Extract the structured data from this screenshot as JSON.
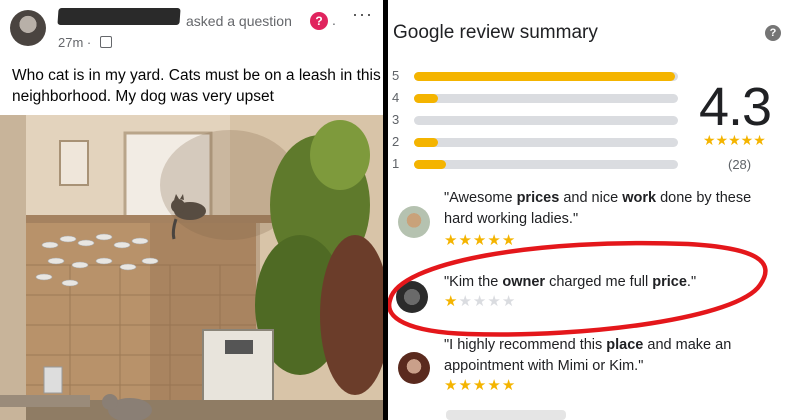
{
  "post": {
    "author_redacted": true,
    "action_text": "asked a question",
    "question_badge": "?",
    "dot": ".",
    "more": "···",
    "time": "27m ·",
    "body": "Who cat is in my yard.   Cats must be on a leash in this neighborhood.  My dog was very upset"
  },
  "review_summary": {
    "title": "Google review summary",
    "help": "?",
    "rating": "4.3",
    "stars": "★★★★★",
    "count": "(28)",
    "bars": [
      {
        "label": "5",
        "fraction": 0.99
      },
      {
        "label": "4",
        "fraction": 0.09
      },
      {
        "label": "3",
        "fraction": 0.0
      },
      {
        "label": "2",
        "fraction": 0.09
      },
      {
        "label": "1",
        "fraction": 0.12
      }
    ],
    "reviews": [
      {
        "parts": [
          "\"Awesome ",
          "prices",
          " and nice ",
          "work",
          " done by these hard working ladies.\""
        ],
        "rating": 5
      },
      {
        "parts": [
          "\"Kim the ",
          "owner",
          " charged me full ",
          "price",
          ".\""
        ],
        "rating": 1
      },
      {
        "parts": [
          "\"I highly recommend this ",
          "place",
          " and make an appointment with Mimi or Kim.\""
        ],
        "rating": 5
      }
    ],
    "annotation_color": "#e4171b",
    "accent_color": "#f4b400"
  }
}
